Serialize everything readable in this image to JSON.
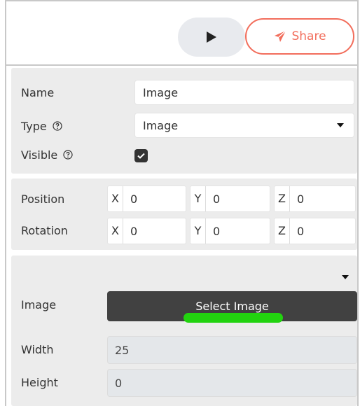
{
  "toolbar": {
    "play_icon": "play-icon",
    "share_icon": "paper-plane-icon",
    "share_label": "Share",
    "accent_color": "#f26d5b"
  },
  "object": {
    "name_label": "Name",
    "name_value": "Image",
    "type_label": "Type",
    "type_value": "Image",
    "visible_label": "Visible",
    "visible_checked": true
  },
  "transform": {
    "position_label": "Position",
    "rotation_label": "Rotation",
    "axes": [
      "X",
      "Y",
      "Z"
    ],
    "position": [
      "0",
      "0",
      "0"
    ],
    "rotation": [
      "0",
      "0",
      "0"
    ]
  },
  "image_props": {
    "image_label": "Image",
    "select_button_label": "Select Image",
    "width_label": "Width",
    "width_value": "25",
    "height_label": "Height",
    "height_value": "0",
    "highlight_color": "#22d30f"
  }
}
